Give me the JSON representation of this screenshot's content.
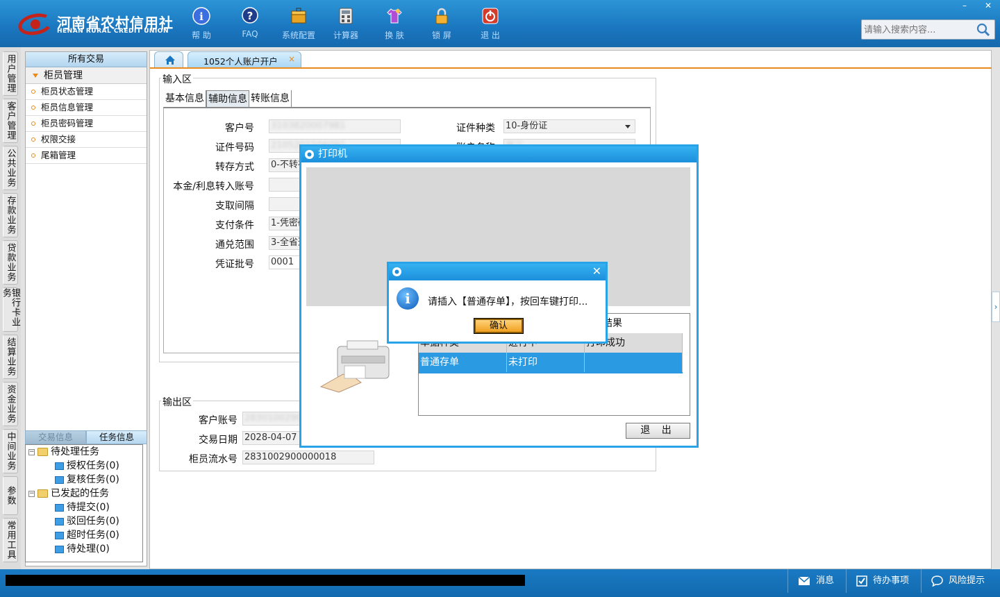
{
  "brand": {
    "cn": "河南省农村信用社",
    "en": "HENAN RURAL CREDIT UNION"
  },
  "toolbar": {
    "help": "帮 助",
    "faq": "FAQ",
    "settings": "系统配置",
    "calc": "计算器",
    "skin": "换 肤",
    "lock": "锁 屏",
    "exit": "退 出"
  },
  "window_controls": {
    "minimize": "–",
    "close": "✕"
  },
  "search": {
    "placeholder": "请输入搜索内容..."
  },
  "side_tabs": [
    "用户管理",
    "客户管理",
    "公共业务",
    "存款业务",
    "贷款业务",
    "银行卡业务",
    "结算业务",
    "资金业务",
    "中间业务",
    "参数",
    "常用工具"
  ],
  "left_panel": {
    "header": "所有交易",
    "group": "柜员管理",
    "items": [
      "柜员状态管理",
      "柜员信息管理",
      "柜员密码管理",
      "权限交接",
      "尾箱管理"
    ]
  },
  "task_tabs": {
    "t1": "交易信息",
    "t2": "任务信息"
  },
  "tree": {
    "pending": "待处理任务",
    "auth": "授权任务(0)",
    "review": "复核任务(0)",
    "initiated": "已发起的任务",
    "to_submit": "待提交(0)",
    "rejected": "驳回任务(0)",
    "timeout": "超时任务(0)",
    "to_process": "待处理(0)"
  },
  "tabs": {
    "active": "1052个人账户开户",
    "close": "×"
  },
  "input_area": {
    "title": "输入区",
    "tabs": [
      "基本信息",
      "辅助信息",
      "转账信息"
    ]
  },
  "form": {
    "customer_no_label": "客户号",
    "customer_no": "3103820007981",
    "id_no_label": "证件号码",
    "id_no": "2105201506091",
    "deposit_mode_label": "转存方式",
    "deposit_mode": "0-不转存",
    "principal_label": "本金/利息转入账号",
    "principal": "",
    "interval_label": "支取间隔",
    "interval": "",
    "pay_cond_label": "支付条件",
    "pay_cond": "1-凭密码",
    "exchange_label": "通兑范围",
    "exchange": "3-全省通兑",
    "batch_label": "凭证批号",
    "batch": "0001",
    "id_type_label": "证件种类",
    "id_type": "10-身份证",
    "account_name_label": "账户名称",
    "account_name": "张三"
  },
  "output_area": {
    "title": "输出区",
    "acct_label": "客户账号",
    "acct": "28301002900018",
    "date_label": "交易日期",
    "date": "2028-04-07",
    "serial_label": "柜员流水号",
    "serial": "2831002900000018"
  },
  "printer": {
    "title": "打印机",
    "result": "结果",
    "columns": [
      "单据种类",
      "进行中",
      "打印成功"
    ],
    "row": [
      "普通存单",
      "未打印",
      ""
    ],
    "exit": "退 出"
  },
  "message": {
    "text": "请插入【普通存单】，按回车键打印...",
    "ok": "确认"
  },
  "status": {
    "msg": "消息",
    "todo": "待办事项",
    "risk": "风险提示"
  },
  "colors": {
    "primary": "#1a76bf",
    "accent": "#e98b1c",
    "dialog_border": "#29a3e8",
    "row_select": "#2a9be2"
  }
}
